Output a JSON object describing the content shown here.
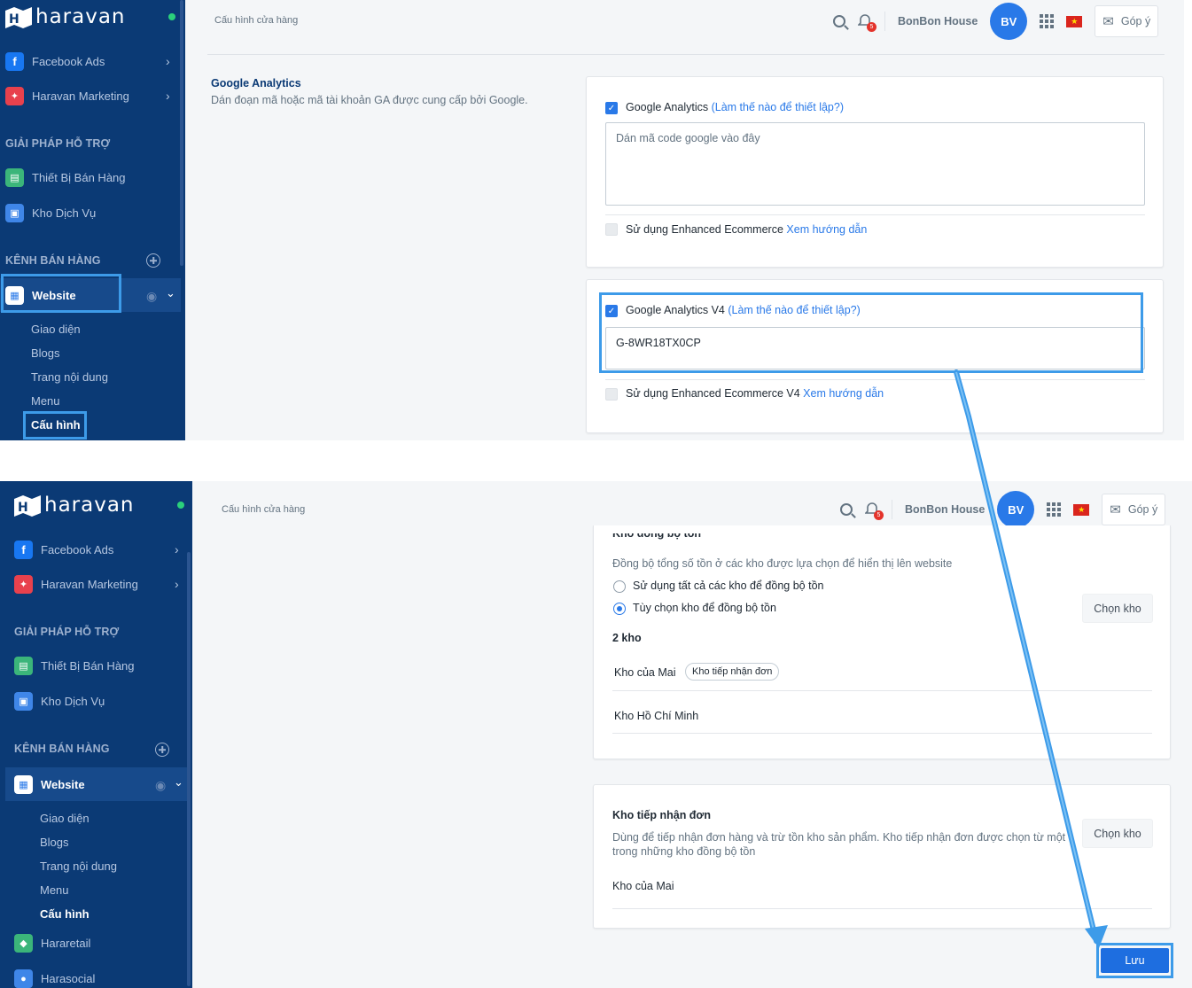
{
  "brand": {
    "logo_text": "haravan",
    "icon_name": "haravan-logo",
    "accent": "#2979e8",
    "sidebar_bg": "#0b3a75",
    "highlight": "#3d9be9"
  },
  "sidebar": {
    "apps": [
      {
        "label": "Facebook Ads",
        "icon": "facebook-icon"
      },
      {
        "label": "Haravan Marketing",
        "icon": "marketing-icon"
      }
    ],
    "support_heading": "GIẢI PHÁP HỖ TRỢ",
    "support_items": [
      {
        "label": "Thiết Bị Bán Hàng",
        "icon": "pos-device-icon"
      },
      {
        "label": "Kho Dịch Vụ",
        "icon": "service-store-icon"
      }
    ],
    "channels_heading": "KÊNH BÁN HÀNG",
    "website_label": "Website",
    "website_sub": [
      "Giao diện",
      "Blogs",
      "Trang nội dung",
      "Menu",
      "Cấu hình"
    ],
    "extra_channels": [
      {
        "label": "Hararetail",
        "icon": "hararetail-icon"
      },
      {
        "label": "Harasocial",
        "icon": "harasocial-icon"
      }
    ]
  },
  "header": {
    "breadcrumb": "Cấu hình cửa hàng",
    "notification_count": "5",
    "shop_name": "BonBon House",
    "avatar_initials": "BV",
    "feedback_label": "Góp ý"
  },
  "ga_section": {
    "title": "Google Analytics",
    "description": "Dán đoạn mã hoặc mã tài khoản GA được cung cấp bởi Google.",
    "ga": {
      "label": "Google Analytics",
      "help": "(Làm thế nào để thiết lập?)",
      "placeholder": "Dán mã code google vào đây",
      "enhanced_label": "Sử dụng Enhanced Ecommerce",
      "enhanced_link": "Xem hướng dẫn"
    },
    "ga4": {
      "label": "Google Analytics V4",
      "help": "(Làm thế nào để thiết lập?)",
      "value": "G-8WR18TX0CP",
      "enhanced_label": "Sử dụng Enhanced Ecommerce V4",
      "enhanced_link": "Xem hướng dẫn"
    }
  },
  "inventory": {
    "cut_title": "Kho đồng bộ tồn",
    "sync_desc": "Đồng bộ tổng số tồn ở các kho được lựa chọn để hiển thị lên website",
    "option_all": "Sử dụng tất cả các kho để đồng bộ tồn",
    "option_custom": "Tùy chọn kho để đồng bộ tồn",
    "choose_label": "Chọn kho",
    "count_label": "2 kho",
    "warehouses": [
      {
        "name": "Kho của Mai",
        "tag": "Kho tiếp nhận đơn"
      },
      {
        "name": "Kho Hồ Chí Minh",
        "tag": ""
      }
    ],
    "order_title": "Kho tiếp nhận đơn",
    "order_desc_1": "Dùng để tiếp nhận đơn hàng và trừ tồn kho sản phẩm. Kho tiếp nhận đơn được chọn từ một",
    "order_desc_2": "trong những kho đồng bộ tồn",
    "order_warehouse": "Kho của Mai",
    "save_label": "Lưu"
  }
}
